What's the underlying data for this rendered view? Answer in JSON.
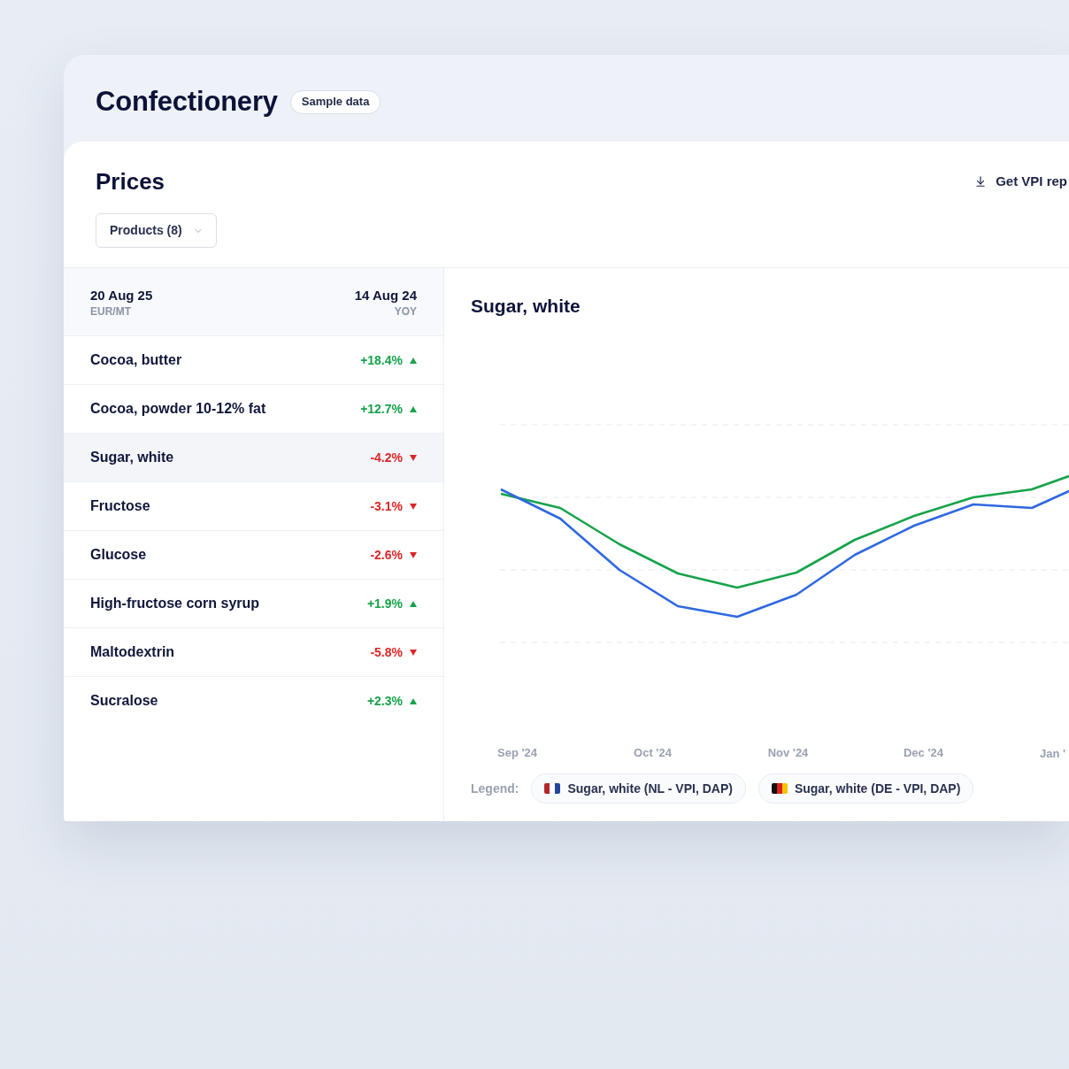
{
  "header": {
    "title": "Confectionery",
    "badge": "Sample data"
  },
  "prices": {
    "title": "Prices",
    "report_button": "Get VPI rep",
    "filter": {
      "label": "Products (8)"
    }
  },
  "table": {
    "date": "20 Aug 25",
    "unit": "EUR/MT",
    "compare_date": "14 Aug 24",
    "compare_label": "YOY",
    "rows": [
      {
        "name": "Cocoa, butter",
        "change": "+18.4%",
        "rising": true,
        "selected": false
      },
      {
        "name": "Cocoa, powder 10-12% fat",
        "change": "+12.7%",
        "rising": true,
        "selected": false
      },
      {
        "name": "Sugar, white",
        "change": "-4.2%",
        "rising": false,
        "selected": true
      },
      {
        "name": "Fructose",
        "change": "-3.1%",
        "rising": false,
        "selected": false
      },
      {
        "name": "Glucose",
        "change": "-2.6%",
        "rising": false,
        "selected": false
      },
      {
        "name": "High-fructose corn syrup",
        "change": "+1.9%",
        "rising": true,
        "selected": false
      },
      {
        "name": "Maltodextrin",
        "change": "-5.8%",
        "rising": false,
        "selected": false
      },
      {
        "name": "Sucralose",
        "change": "+2.3%",
        "rising": true,
        "selected": false
      }
    ]
  },
  "chart": {
    "title": "Sugar, white",
    "x_labels": [
      "Sep '24",
      "Oct '24",
      "Nov '24",
      "Dec '24",
      "Jan '"
    ],
    "legend_label": "Legend:",
    "legend": [
      {
        "label": "Sugar, white (NL - VPI, DAP)",
        "kind": "nl"
      },
      {
        "label": "Sugar, white (DE - VPI, DAP)",
        "kind": "de"
      }
    ]
  }
}
